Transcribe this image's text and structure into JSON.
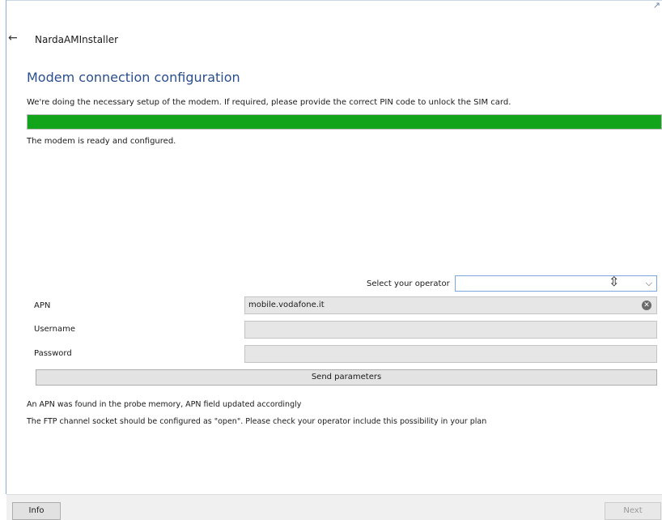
{
  "window": {
    "back_icon": "back-arrow-icon",
    "title": "NardaAMInstaller"
  },
  "page": {
    "heading": "Modem connection configuration",
    "intro": "We're doing the necessary setup of the modem. If required, please provide the correct PIN code to unlock the SIM card.",
    "progress_percent": 100,
    "progress_color": "#12a41b",
    "status": "The modem is ready and configured."
  },
  "form": {
    "operator_label": "Select your operator",
    "operator_value": "",
    "apn_label": "APN",
    "apn_value": "mobile.vodafone.it",
    "username_label": "Username",
    "username_value": "",
    "password_label": "Password",
    "password_value": "",
    "send_label": "Send parameters"
  },
  "messages": {
    "line1": "An APN was found in the probe memory, APN field updated accordingly",
    "line2": "The FTP channel socket should be configured as \"open\". Please check your operator include this possibility in your plan"
  },
  "footer": {
    "info_label": "Info",
    "next_label": "Next"
  }
}
